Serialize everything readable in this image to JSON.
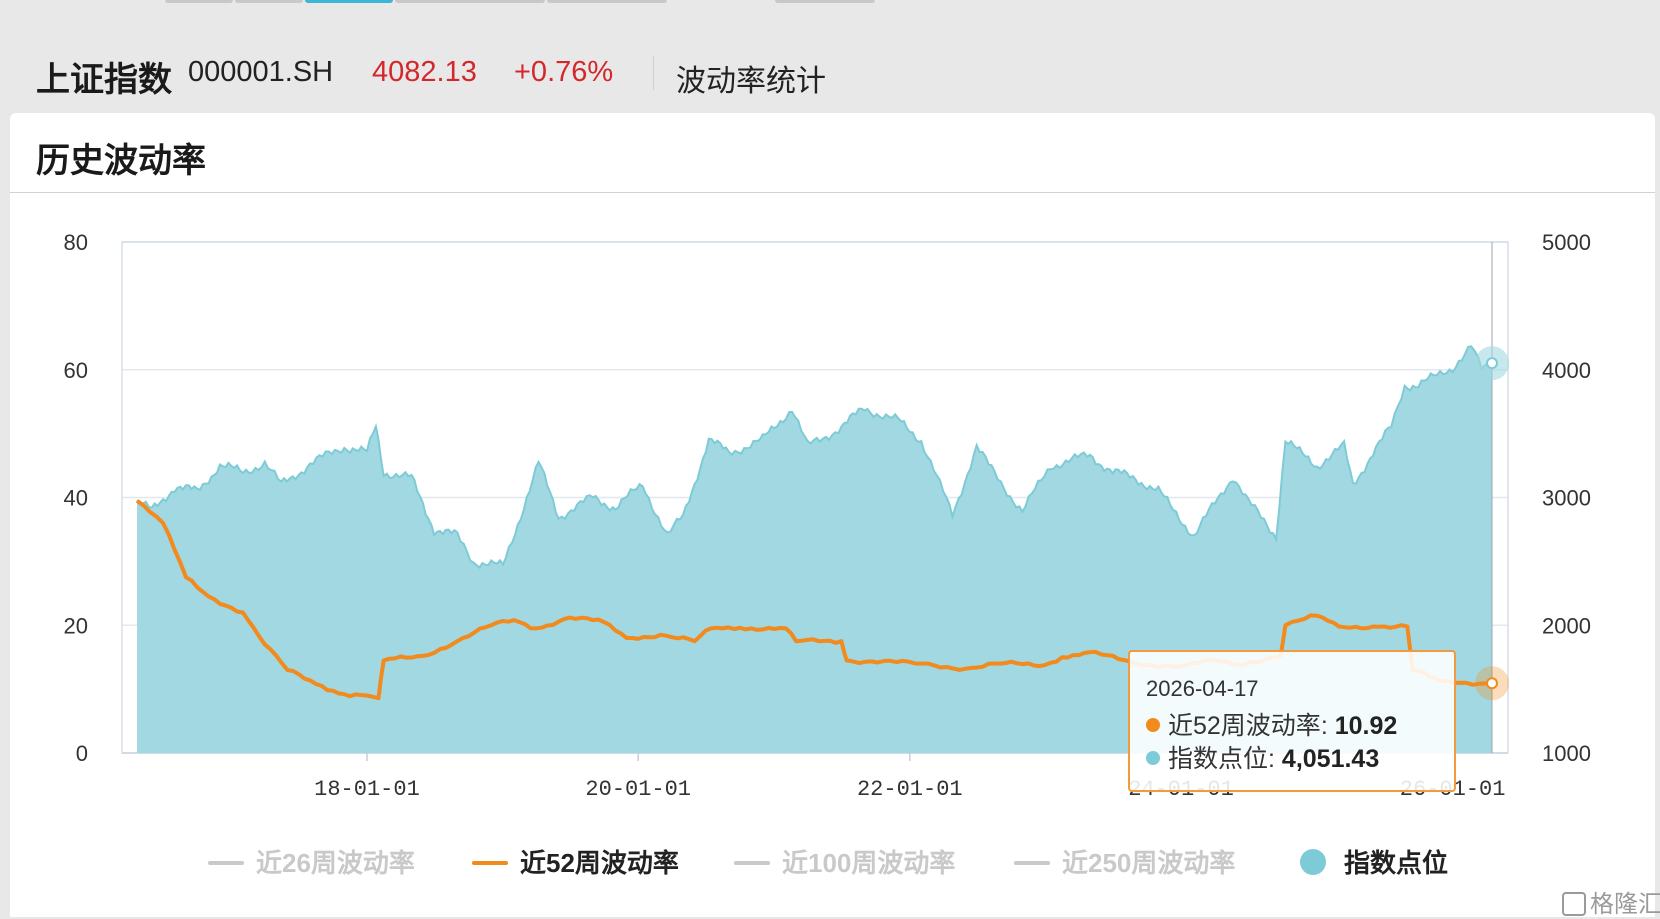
{
  "header": {
    "name": "上证指数",
    "code": "000001.SH",
    "price": "4082.13",
    "change": "+0.76%",
    "stats_link": "波动率统计"
  },
  "card": {
    "title": "历史波动率"
  },
  "colors": {
    "index_fill": "#a1d8e1",
    "index_line": "#7ecbd8",
    "vol52": "#f28a1d",
    "price_red": "#d4272c",
    "inactive_legend": "#c9c9c9"
  },
  "chart_data": {
    "type": "line",
    "x_axis": {
      "range": [
        "2016-04-22",
        "2026-04-17"
      ],
      "ticks": [
        "18-01-01",
        "20-01-01",
        "22-01-01",
        "24-01-01",
        "26-01-01"
      ]
    },
    "y_left": {
      "range": [
        0,
        80
      ],
      "ticks": [
        "0",
        "20",
        "40",
        "60",
        "80"
      ]
    },
    "y_right": {
      "range": [
        1000,
        5000
      ],
      "ticks": [
        "1000",
        "2000",
        "3000",
        "4000",
        "5000"
      ]
    },
    "grid": true,
    "legend_position": "bottom",
    "series": [
      {
        "name": "近26周波动率",
        "visible": false,
        "values": []
      },
      {
        "name": "近52周波动率",
        "visible": true,
        "axis": "left",
        "points": [
          [
            "2016-04-22",
            39.5
          ],
          [
            "2016-07-01",
            36.0
          ],
          [
            "2016-09-01",
            27.5
          ],
          [
            "2016-11-01",
            24.5
          ],
          [
            "2017-02-01",
            22.0
          ],
          [
            "2017-04-01",
            17.0
          ],
          [
            "2017-06-01",
            13.0
          ],
          [
            "2017-09-01",
            10.5
          ],
          [
            "2017-11-01",
            9.2
          ],
          [
            "2018-01-01",
            9.0
          ],
          [
            "2018-02-01",
            8.6
          ],
          [
            "2018-02-15",
            14.5
          ],
          [
            "2018-06-01",
            15.2
          ],
          [
            "2018-09-01",
            17.5
          ],
          [
            "2018-12-01",
            20.0
          ],
          [
            "2019-02-01",
            20.8
          ],
          [
            "2019-04-01",
            19.5
          ],
          [
            "2019-07-01",
            21.2
          ],
          [
            "2019-10-01",
            20.5
          ],
          [
            "2019-12-01",
            18.0
          ],
          [
            "2020-03-01",
            18.5
          ],
          [
            "2020-06-01",
            17.5
          ],
          [
            "2020-07-15",
            19.5
          ],
          [
            "2020-10-01",
            19.6
          ],
          [
            "2021-02-01",
            19.5
          ],
          [
            "2021-03-01",
            17.5
          ],
          [
            "2021-07-01",
            17.5
          ],
          [
            "2021-07-15",
            14.5
          ],
          [
            "2022-02-01",
            14.0
          ],
          [
            "2022-06-01",
            13.2
          ],
          [
            "2022-09-01",
            14.0
          ],
          [
            "2023-01-01",
            13.8
          ],
          [
            "2023-02-15",
            15.0
          ],
          [
            "2023-05-01",
            15.8
          ],
          [
            "2023-09-01",
            14.0
          ],
          [
            "2024-01-01",
            13.6
          ],
          [
            "2024-04-01",
            14.5
          ],
          [
            "2024-06-01",
            13.8
          ],
          [
            "2024-09-01",
            15.0
          ],
          [
            "2024-09-25",
            15.2
          ],
          [
            "2024-10-08",
            20.0
          ],
          [
            "2025-01-01",
            21.5
          ],
          [
            "2025-03-01",
            19.8
          ],
          [
            "2025-06-01",
            19.8
          ],
          [
            "2025-07-01",
            19.8
          ],
          [
            "2025-09-01",
            19.8
          ],
          [
            "2025-09-15",
            13.0
          ],
          [
            "2025-12-01",
            11.2
          ],
          [
            "2026-04-17",
            10.92
          ]
        ]
      },
      {
        "name": "近100周波动率",
        "visible": false,
        "values": []
      },
      {
        "name": "近250周波动率",
        "visible": false,
        "values": []
      },
      {
        "name": "指数点位",
        "visible": true,
        "type": "area",
        "axis": "right",
        "points": [
          [
            "2016-04-22",
            2960
          ],
          [
            "2016-06-01",
            2900
          ],
          [
            "2016-08-01",
            3080
          ],
          [
            "2016-10-01",
            3050
          ],
          [
            "2016-12-01",
            3250
          ],
          [
            "2017-02-01",
            3200
          ],
          [
            "2017-04-01",
            3270
          ],
          [
            "2017-05-15",
            3100
          ],
          [
            "2017-08-01",
            3260
          ],
          [
            "2017-11-01",
            3400
          ],
          [
            "2018-01-01",
            3350
          ],
          [
            "2018-01-25",
            3560
          ],
          [
            "2018-02-15",
            3200
          ],
          [
            "2018-05-01",
            3150
          ],
          [
            "2018-07-01",
            2750
          ],
          [
            "2018-09-01",
            2700
          ],
          [
            "2018-10-15",
            2500
          ],
          [
            "2019-01-02",
            2460
          ],
          [
            "2019-04-08",
            3270
          ],
          [
            "2019-06-01",
            2850
          ],
          [
            "2019-09-01",
            3000
          ],
          [
            "2019-11-01",
            2920
          ],
          [
            "2020-01-13",
            3100
          ],
          [
            "2020-03-20",
            2700
          ],
          [
            "2020-05-01",
            2850
          ],
          [
            "2020-07-09",
            3450
          ],
          [
            "2020-09-01",
            3350
          ],
          [
            "2020-12-01",
            3450
          ],
          [
            "2021-02-18",
            3700
          ],
          [
            "2021-04-01",
            3400
          ],
          [
            "2021-07-01",
            3550
          ],
          [
            "2021-09-01",
            3700
          ],
          [
            "2021-12-01",
            3600
          ],
          [
            "2022-02-01",
            3450
          ],
          [
            "2022-04-26",
            2860
          ],
          [
            "2022-06-30",
            3400
          ],
          [
            "2022-08-01",
            3250
          ],
          [
            "2022-10-31",
            2890
          ],
          [
            "2023-01-15",
            3250
          ],
          [
            "2023-05-01",
            3330
          ],
          [
            "2023-07-01",
            3200
          ],
          [
            "2023-09-01",
            3150
          ],
          [
            "2023-11-01",
            3050
          ],
          [
            "2024-02-05",
            2700
          ],
          [
            "2024-05-20",
            3170
          ],
          [
            "2024-07-01",
            2960
          ],
          [
            "2024-09-13",
            2700
          ],
          [
            "2024-10-08",
            3450
          ],
          [
            "2024-11-15",
            3350
          ],
          [
            "2025-01-01",
            3250
          ],
          [
            "2025-03-15",
            3400
          ],
          [
            "2025-04-08",
            3100
          ],
          [
            "2025-06-01",
            3350
          ],
          [
            "2025-07-20",
            3550
          ],
          [
            "2025-08-25",
            3880
          ],
          [
            "2025-10-01",
            3880
          ],
          [
            "2025-11-20",
            3950
          ],
          [
            "2026-01-01",
            4020
          ],
          [
            "2026-02-20",
            4180
          ],
          [
            "2026-03-20",
            4000
          ],
          [
            "2026-04-17",
            4051.43
          ]
        ]
      }
    ],
    "tooltip": {
      "date": "2026-04-17",
      "rows": [
        {
          "label": "近52周波动率",
          "value": "10.92"
        },
        {
          "label": "指数点位",
          "value": "4,051.43"
        }
      ]
    }
  },
  "watermark": "格隆汇"
}
